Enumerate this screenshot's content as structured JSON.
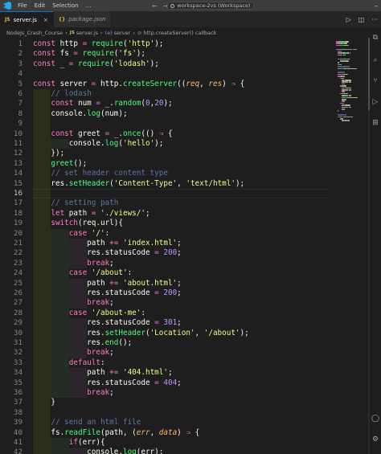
{
  "titlebar": {
    "menu": [
      "File",
      "Edit",
      "Selection",
      "…"
    ],
    "back_icon": "arrow-left-icon",
    "forward_icon": "arrow-right-icon",
    "command_center": "workspace-2vs (Workspace)"
  },
  "tabs": [
    {
      "label": "server.js",
      "badge": "JS",
      "active": true,
      "close": "×"
    },
    {
      "label": "package.json",
      "badge": "{}",
      "active": false
    }
  ],
  "tab_actions": {
    "run": "▷",
    "split": "◫",
    "more": "···"
  },
  "breadcrumb": {
    "folder": "NodeJs_Crash_Course",
    "file_badge": "JS",
    "file": "server.js",
    "symbol_badge": "(e)",
    "symbol": "server",
    "callback_badge": "⊘",
    "callback": "http.createServer() callback"
  },
  "editor": {
    "current_line": 16,
    "lines": [
      {
        "n": "1",
        "indent": 0,
        "tokens": [
          [
            "kw",
            "const"
          ],
          [
            "var",
            " http "
          ],
          [
            "op",
            "="
          ],
          [
            "pn",
            " "
          ],
          [
            "fn",
            "require"
          ],
          [
            "pn",
            "("
          ],
          [
            "str",
            "'http'"
          ],
          [
            "pn",
            ");"
          ]
        ]
      },
      {
        "n": "2",
        "indent": 0,
        "tokens": [
          [
            "kw",
            "const"
          ],
          [
            "var",
            " fs "
          ],
          [
            "op",
            "="
          ],
          [
            "pn",
            " "
          ],
          [
            "fn",
            "require"
          ],
          [
            "pn",
            "("
          ],
          [
            "str",
            "'fs'"
          ],
          [
            "pn",
            ");"
          ]
        ]
      },
      {
        "n": "3",
        "indent": 0,
        "tokens": [
          [
            "kw",
            "const"
          ],
          [
            "var",
            " _ "
          ],
          [
            "op",
            "="
          ],
          [
            "pn",
            " "
          ],
          [
            "fn",
            "require"
          ],
          [
            "pn",
            "("
          ],
          [
            "str",
            "'lodash'"
          ],
          [
            "pn",
            ");"
          ]
        ]
      },
      {
        "n": "4",
        "indent": 0,
        "tokens": []
      },
      {
        "n": "5",
        "indent": 0,
        "tokens": [
          [
            "kw",
            "const"
          ],
          [
            "var",
            " server "
          ],
          [
            "op",
            "="
          ],
          [
            "pn",
            " "
          ],
          [
            "var",
            "http"
          ],
          [
            "pn",
            "."
          ],
          [
            "fn",
            "createServer"
          ],
          [
            "pn",
            "(("
          ],
          [
            "pm",
            "req"
          ],
          [
            "pn",
            ", "
          ],
          [
            "pm",
            "res"
          ],
          [
            "pn",
            ") "
          ],
          [
            "op",
            "⇒"
          ],
          [
            "pn",
            " {"
          ]
        ]
      },
      {
        "n": "6",
        "indent": 1,
        "tokens": [
          [
            "cm",
            "// lodash"
          ]
        ]
      },
      {
        "n": "7",
        "indent": 1,
        "tokens": [
          [
            "kw",
            "const"
          ],
          [
            "var",
            " num "
          ],
          [
            "op",
            "="
          ],
          [
            "pn",
            " "
          ],
          [
            "var",
            "_"
          ],
          [
            "pn",
            "."
          ],
          [
            "fn",
            "random"
          ],
          [
            "pn",
            "("
          ],
          [
            "num",
            "0"
          ],
          [
            "pn",
            ","
          ],
          [
            "num",
            "20"
          ],
          [
            "pn",
            ");"
          ]
        ]
      },
      {
        "n": "8",
        "indent": 1,
        "tokens": [
          [
            "var",
            "console"
          ],
          [
            "pn",
            "."
          ],
          [
            "fn",
            "log"
          ],
          [
            "pn",
            "("
          ],
          [
            "var",
            "num"
          ],
          [
            "pn",
            ");"
          ]
        ]
      },
      {
        "n": "9",
        "indent": 1,
        "tokens": []
      },
      {
        "n": "10",
        "indent": 1,
        "tokens": [
          [
            "kw",
            "const"
          ],
          [
            "var",
            " greet "
          ],
          [
            "op",
            "="
          ],
          [
            "pn",
            " "
          ],
          [
            "var",
            "_"
          ],
          [
            "pn",
            "."
          ],
          [
            "fn",
            "once"
          ],
          [
            "pn",
            "(() "
          ],
          [
            "op",
            "⇒"
          ],
          [
            "pn",
            " {"
          ]
        ]
      },
      {
        "n": "11",
        "indent": 2,
        "tokens": [
          [
            "var",
            "console"
          ],
          [
            "pn",
            "."
          ],
          [
            "fn",
            "log"
          ],
          [
            "pn",
            "("
          ],
          [
            "str",
            "'hello'"
          ],
          [
            "pn",
            ");"
          ]
        ]
      },
      {
        "n": "12",
        "indent": 1,
        "tokens": [
          [
            "pn",
            "});"
          ]
        ]
      },
      {
        "n": "13",
        "indent": 1,
        "tokens": [
          [
            "fn",
            "greet"
          ],
          [
            "pn",
            "();"
          ]
        ]
      },
      {
        "n": "14",
        "indent": 1,
        "tokens": [
          [
            "cm",
            "// set header content type"
          ]
        ]
      },
      {
        "n": "15",
        "indent": 1,
        "tokens": [
          [
            "var",
            "res"
          ],
          [
            "pn",
            "."
          ],
          [
            "fn",
            "setHeader"
          ],
          [
            "pn",
            "("
          ],
          [
            "str",
            "'Content-Type'"
          ],
          [
            "pn",
            ", "
          ],
          [
            "str",
            "'text/html'"
          ],
          [
            "pn",
            ");"
          ]
        ]
      },
      {
        "n": "16",
        "indent": 1,
        "tokens": []
      },
      {
        "n": "17",
        "indent": 1,
        "tokens": [
          [
            "cm",
            "// setting path"
          ]
        ]
      },
      {
        "n": "18",
        "indent": 1,
        "tokens": [
          [
            "kw",
            "let"
          ],
          [
            "var",
            " path "
          ],
          [
            "op",
            "="
          ],
          [
            "pn",
            " "
          ],
          [
            "str",
            "'./views/'"
          ],
          [
            "pn",
            ";"
          ]
        ]
      },
      {
        "n": "19",
        "indent": 1,
        "tokens": [
          [
            "kw",
            "switch"
          ],
          [
            "pn",
            "("
          ],
          [
            "var",
            "req"
          ],
          [
            "pn",
            "."
          ],
          [
            "var",
            "url"
          ],
          [
            "pn",
            "){"
          ]
        ]
      },
      {
        "n": "20",
        "indent": 2,
        "tokens": [
          [
            "kw",
            "case"
          ],
          [
            "pn",
            " "
          ],
          [
            "str",
            "'/'"
          ],
          [
            "pn",
            ":"
          ]
        ]
      },
      {
        "n": "21",
        "indent": 3,
        "tokens": [
          [
            "var",
            "path "
          ],
          [
            "op",
            "+="
          ],
          [
            "pn",
            " "
          ],
          [
            "str",
            "'index.html'"
          ],
          [
            "pn",
            ";"
          ]
        ]
      },
      {
        "n": "22",
        "indent": 3,
        "tokens": [
          [
            "var",
            "res"
          ],
          [
            "pn",
            "."
          ],
          [
            "var",
            "statusCode "
          ],
          [
            "op",
            "="
          ],
          [
            "pn",
            " "
          ],
          [
            "num",
            "200"
          ],
          [
            "pn",
            ";"
          ]
        ]
      },
      {
        "n": "23",
        "indent": 3,
        "tokens": [
          [
            "kw",
            "break"
          ],
          [
            "pn",
            ";"
          ]
        ]
      },
      {
        "n": "24",
        "indent": 2,
        "tokens": [
          [
            "kw",
            "case"
          ],
          [
            "pn",
            " "
          ],
          [
            "str",
            "'/about'"
          ],
          [
            "pn",
            ":"
          ]
        ]
      },
      {
        "n": "25",
        "indent": 3,
        "tokens": [
          [
            "var",
            "path "
          ],
          [
            "op",
            "+="
          ],
          [
            "pn",
            " "
          ],
          [
            "str",
            "'about.html'"
          ],
          [
            "pn",
            ";"
          ]
        ]
      },
      {
        "n": "26",
        "indent": 3,
        "tokens": [
          [
            "var",
            "res"
          ],
          [
            "pn",
            "."
          ],
          [
            "var",
            "statusCode "
          ],
          [
            "op",
            "="
          ],
          [
            "pn",
            " "
          ],
          [
            "num",
            "200"
          ],
          [
            "pn",
            ";"
          ]
        ]
      },
      {
        "n": "27",
        "indent": 3,
        "tokens": [
          [
            "kw",
            "break"
          ],
          [
            "pn",
            ";"
          ]
        ]
      },
      {
        "n": "28",
        "indent": 2,
        "tokens": [
          [
            "kw",
            "case"
          ],
          [
            "pn",
            " "
          ],
          [
            "str",
            "'/about-me'"
          ],
          [
            "pn",
            ":"
          ]
        ]
      },
      {
        "n": "29",
        "indent": 3,
        "tokens": [
          [
            "var",
            "res"
          ],
          [
            "pn",
            "."
          ],
          [
            "var",
            "statusCode "
          ],
          [
            "op",
            "="
          ],
          [
            "pn",
            " "
          ],
          [
            "num",
            "301"
          ],
          [
            "pn",
            ";"
          ]
        ]
      },
      {
        "n": "30",
        "indent": 3,
        "tokens": [
          [
            "var",
            "res"
          ],
          [
            "pn",
            "."
          ],
          [
            "fn",
            "setHeader"
          ],
          [
            "pn",
            "("
          ],
          [
            "str",
            "'Location'"
          ],
          [
            "pn",
            ", "
          ],
          [
            "str",
            "'/about'"
          ],
          [
            "pn",
            ");"
          ]
        ]
      },
      {
        "n": "31",
        "indent": 3,
        "tokens": [
          [
            "var",
            "res"
          ],
          [
            "pn",
            "."
          ],
          [
            "fn",
            "end"
          ],
          [
            "pn",
            "();"
          ]
        ]
      },
      {
        "n": "32",
        "indent": 3,
        "tokens": [
          [
            "kw",
            "break"
          ],
          [
            "pn",
            ";"
          ]
        ]
      },
      {
        "n": "33",
        "indent": 2,
        "tokens": [
          [
            "kw",
            "default"
          ],
          [
            "pn",
            ":"
          ]
        ]
      },
      {
        "n": "34",
        "indent": 3,
        "tokens": [
          [
            "var",
            "path "
          ],
          [
            "op",
            "+="
          ],
          [
            "pn",
            " "
          ],
          [
            "str",
            "'404.html'"
          ],
          [
            "pn",
            ";"
          ]
        ]
      },
      {
        "n": "35",
        "indent": 3,
        "tokens": [
          [
            "var",
            "res"
          ],
          [
            "pn",
            "."
          ],
          [
            "var",
            "statusCode "
          ],
          [
            "op",
            "="
          ],
          [
            "pn",
            " "
          ],
          [
            "num",
            "404"
          ],
          [
            "pn",
            ";"
          ]
        ]
      },
      {
        "n": "36",
        "indent": 3,
        "tokens": [
          [
            "kw",
            "break"
          ],
          [
            "pn",
            ";"
          ]
        ]
      },
      {
        "n": "37",
        "indent": 1,
        "tokens": [
          [
            "pn",
            "}"
          ]
        ]
      },
      {
        "n": "38",
        "indent": 1,
        "tokens": []
      },
      {
        "n": "39",
        "indent": 1,
        "tokens": [
          [
            "cm",
            "// send an html file"
          ]
        ]
      },
      {
        "n": "40",
        "indent": 1,
        "tokens": [
          [
            "var",
            "fs"
          ],
          [
            "pn",
            "."
          ],
          [
            "fn",
            "readFile"
          ],
          [
            "pn",
            "("
          ],
          [
            "var",
            "path"
          ],
          [
            "pn",
            ", ("
          ],
          [
            "pm",
            "err"
          ],
          [
            "pn",
            ", "
          ],
          [
            "pm",
            "data"
          ],
          [
            "pn",
            ") "
          ],
          [
            "op",
            "⇒"
          ],
          [
            "pn",
            " {"
          ]
        ]
      },
      {
        "n": "41",
        "indent": 2,
        "tokens": [
          [
            "kw",
            "if"
          ],
          [
            "pn",
            "("
          ],
          [
            "var",
            "err"
          ],
          [
            "pn",
            "){"
          ]
        ]
      },
      {
        "n": "42",
        "indent": 3,
        "tokens": [
          [
            "var",
            "console"
          ],
          [
            "pn",
            "."
          ],
          [
            "fn",
            "log"
          ],
          [
            "pn",
            "("
          ],
          [
            "var",
            "err"
          ],
          [
            "pn",
            ");"
          ]
        ]
      }
    ]
  },
  "right_rail_icons": [
    "copy-icon",
    "search-icon",
    "source-control-icon",
    "run-debug-icon",
    "extensions-icon",
    "account-icon",
    "settings-icon"
  ],
  "colors": {
    "keyword": "#ff79c6",
    "function": "#50fa7b",
    "string": "#f1fa8c",
    "number": "#bd93f9",
    "comment": "#6272a4",
    "parameter": "#ffb86c",
    "text": "#f8f8f2"
  }
}
